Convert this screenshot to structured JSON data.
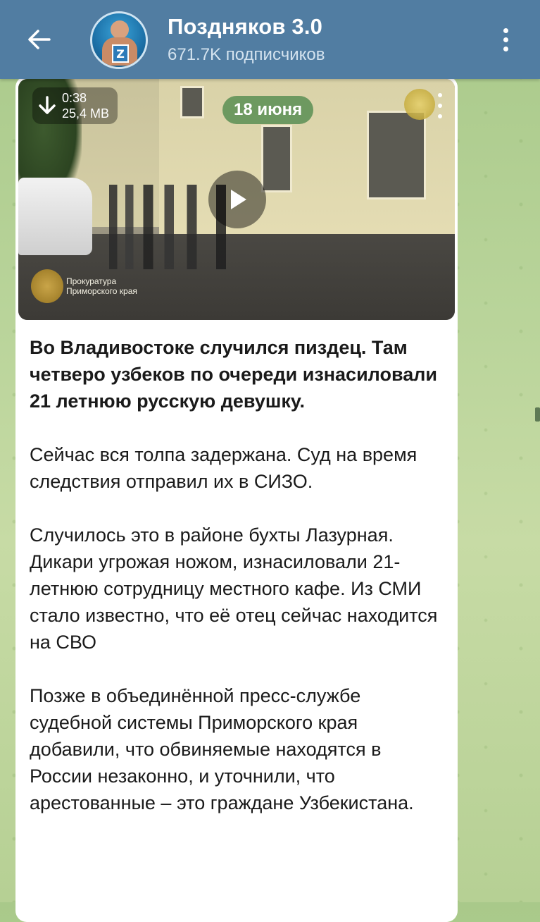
{
  "header": {
    "title": "Поздняков 3.0",
    "subscribers": "671.7K подписчиков",
    "background_color": "#517da2"
  },
  "message": {
    "video": {
      "duration": "0:38",
      "size": "25,4 MB",
      "date": "18 июня",
      "watermark_line1": "Прокуратура",
      "watermark_line2": "Приморского края"
    },
    "text_bold": "Во Владивостоке случился пиздец. Там четверо узбеков по очереди изнасиловали 21 летнюю русскую девушку.",
    "paragraphs": [
      "Сейчас вся толпа задержана. Суд на время следствия отправил их в СИЗО.",
      "Случилось это в районе бухты Лазурная. Дикари угрожая ножом, изнасиловали 21-летнюю сотрудницу местного кафе. Из СМИ стало известно, что её отец сейчас находится на СВО",
      "Позже в объединённой пресс-службе судебной системы Приморского края добавили, что обвиняемые находятся в России незаконно, и уточнили, что арестованные – это граждане Узбекистана."
    ]
  },
  "icons": {
    "back": "arrow-left-icon",
    "menu": "more-vertical-icon",
    "download": "download-arrow-icon",
    "play": "play-icon"
  }
}
